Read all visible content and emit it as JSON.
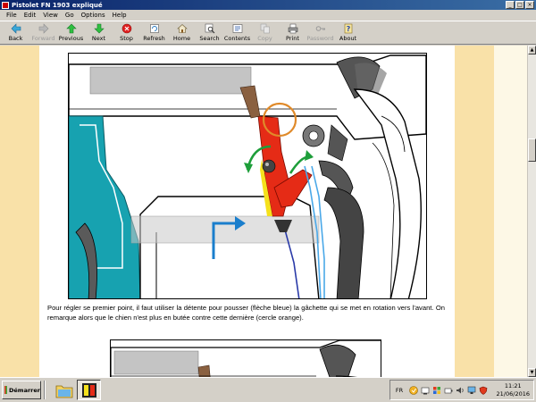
{
  "window": {
    "title": "Pistolet FN 1903 expliqué",
    "controls": [
      "_",
      "□",
      "×"
    ]
  },
  "menu": [
    "File",
    "Edit",
    "View",
    "Go",
    "Options",
    "Help"
  ],
  "toolbar": [
    {
      "label": "Back",
      "icon": "back-arrow-icon",
      "enabled": true
    },
    {
      "label": "Forward",
      "icon": "forward-arrow-icon",
      "enabled": false
    },
    {
      "label": "Previous",
      "icon": "up-arrow-icon",
      "enabled": true
    },
    {
      "label": "Next",
      "icon": "down-arrow-icon",
      "enabled": true
    },
    {
      "label": "Stop",
      "icon": "stop-icon",
      "enabled": true
    },
    {
      "label": "Refresh",
      "icon": "refresh-icon",
      "enabled": true
    },
    {
      "label": "Home",
      "icon": "home-icon",
      "enabled": true
    },
    {
      "label": "Search",
      "icon": "search-icon",
      "enabled": true
    },
    {
      "label": "Contents",
      "icon": "contents-icon",
      "enabled": true
    },
    {
      "label": "Copy",
      "icon": "copy-icon",
      "enabled": false
    },
    {
      "label": "Print",
      "icon": "print-icon",
      "enabled": true
    },
    {
      "label": "Password",
      "icon": "key-icon",
      "enabled": false
    },
    {
      "label": "About",
      "icon": "help-icon",
      "enabled": true
    }
  ],
  "content": {
    "caption": "Pour régler se premier point, il faut utiliser la détente pour pousser (flèche bleue) la gâchette qui se met en rotation vers l'avant. On remarque alors que le chien n'est plus en butée contre cette dernière (cercle orange).",
    "colors": {
      "page_bg": "#fdf8e6",
      "band": "#f9e1a8",
      "frame_teal": "#17a2b0",
      "hammer": "#555555",
      "sear_red": "#e52b16",
      "arrow_blue": "#1a7ecc",
      "arrow_green": "#1e9e3a",
      "circle_orange": "#e08a2a"
    }
  },
  "taskbar": {
    "start_label": "Démarrer",
    "language": "FR",
    "time": "11:21",
    "date": "21/06/2016"
  }
}
